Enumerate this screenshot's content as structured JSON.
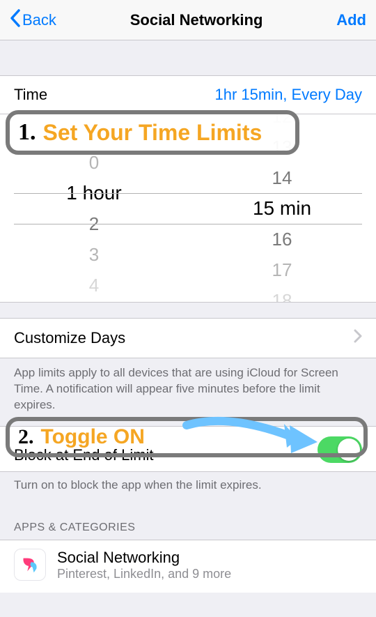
{
  "nav": {
    "back_label": "Back",
    "title": "Social Networking",
    "add_label": "Add"
  },
  "time_row": {
    "label": "Time",
    "value": "1hr 15min, Every Day"
  },
  "picker": {
    "hours": {
      "prev2": "",
      "prev1": "0",
      "selected": "1",
      "selected_unit": "hour",
      "next1": "2",
      "next2": "3",
      "next3": "4"
    },
    "minutes": {
      "prev3": "12",
      "prev2": "13",
      "prev1": "14",
      "selected": "15",
      "selected_unit": "min",
      "next1": "16",
      "next2": "17",
      "next3": "18"
    }
  },
  "customize": {
    "label": "Customize Days"
  },
  "limits_footer": "App limits apply to all devices that are using iCloud for Screen Time. A notification will appear five minutes before the limit expires.",
  "block": {
    "label": "Block at End of Limit",
    "on": true
  },
  "block_footer": "Turn on to block the app when the limit expires.",
  "apps_header": "APPS & CATEGORIES",
  "app": {
    "title": "Social Networking",
    "subtitle": "Pinterest, LinkedIn, and 9 more"
  },
  "annotations": {
    "a1_num": "1.",
    "a1_text": "Set Your Time Limits",
    "a2_num": "2.",
    "a2_text": "Toggle ON"
  }
}
